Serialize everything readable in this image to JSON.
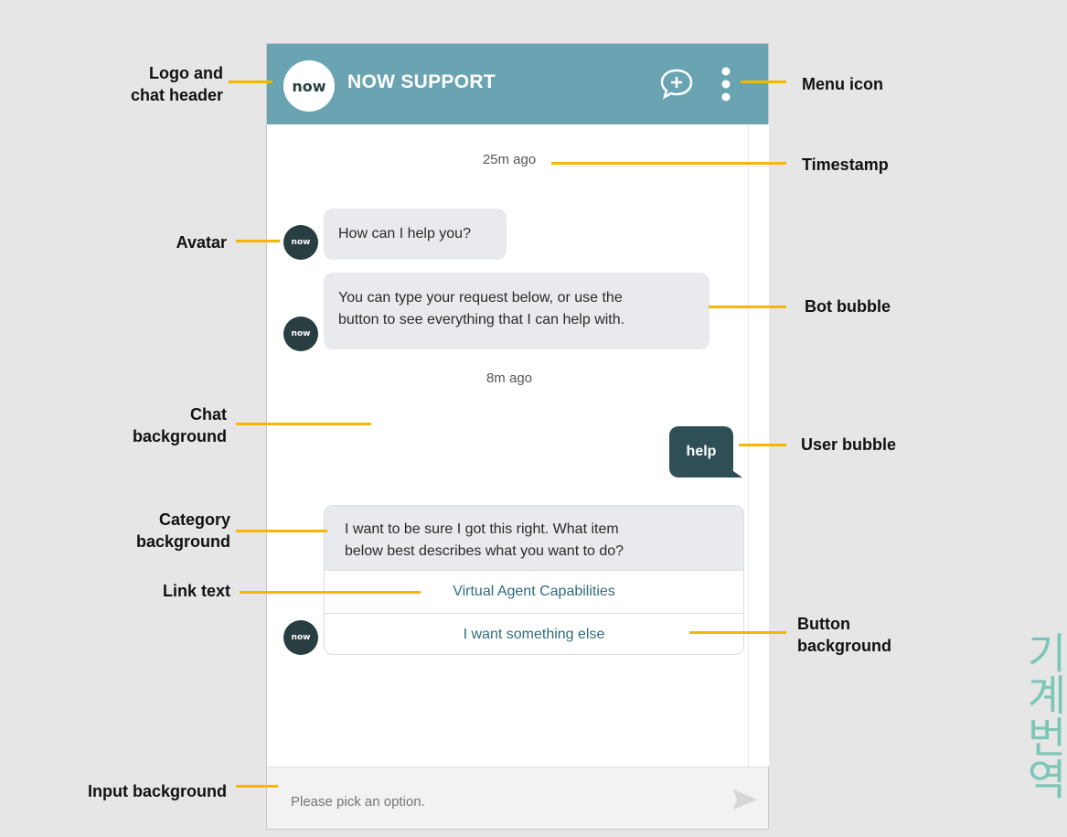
{
  "header": {
    "logo_text": "now",
    "title": "NOW SUPPORT",
    "new_chat_icon": "chat-plus-icon",
    "menu_icon": "vertical-ellipsis-icon"
  },
  "chat": {
    "timestamp_1": "25m ago",
    "avatar_text": "now",
    "bot_message_1": "How can I help you?",
    "bot_message_2_line1": "You can type your request below, or use the",
    "bot_message_2_line2": "button to see everything that I can help with.",
    "timestamp_2": "8m ago",
    "user_message": "help",
    "category_line1": "I want to be sure I got this right. What item",
    "category_line2": "below best describes what you want to do?",
    "options": [
      "Virtual Agent Capabilities",
      "I want something else"
    ]
  },
  "input": {
    "placeholder": "Please pick an option.",
    "send_icon": "send-arrow-icon"
  },
  "callouts": {
    "logo_header": [
      "Logo and",
      "chat header"
    ],
    "menu_icon": "Menu icon",
    "timestamp": "Timestamp",
    "avatar": "Avatar",
    "bot_bubble": "Bot bubble",
    "chat_background": [
      "Chat",
      "background"
    ],
    "user_bubble": "User bubble",
    "category_background": [
      "Category",
      "background"
    ],
    "link_text": "Link text",
    "button_background": [
      "Button",
      "background"
    ],
    "input_background": "Input background"
  },
  "watermark": "기계번역",
  "colors": {
    "header": "#6aa4b3",
    "callout": "#f5b700",
    "avatar": "#293e40",
    "user_bubble": "#2f4f57",
    "bot_bubble": "#e8eaed",
    "link": "#2e6d7a"
  }
}
